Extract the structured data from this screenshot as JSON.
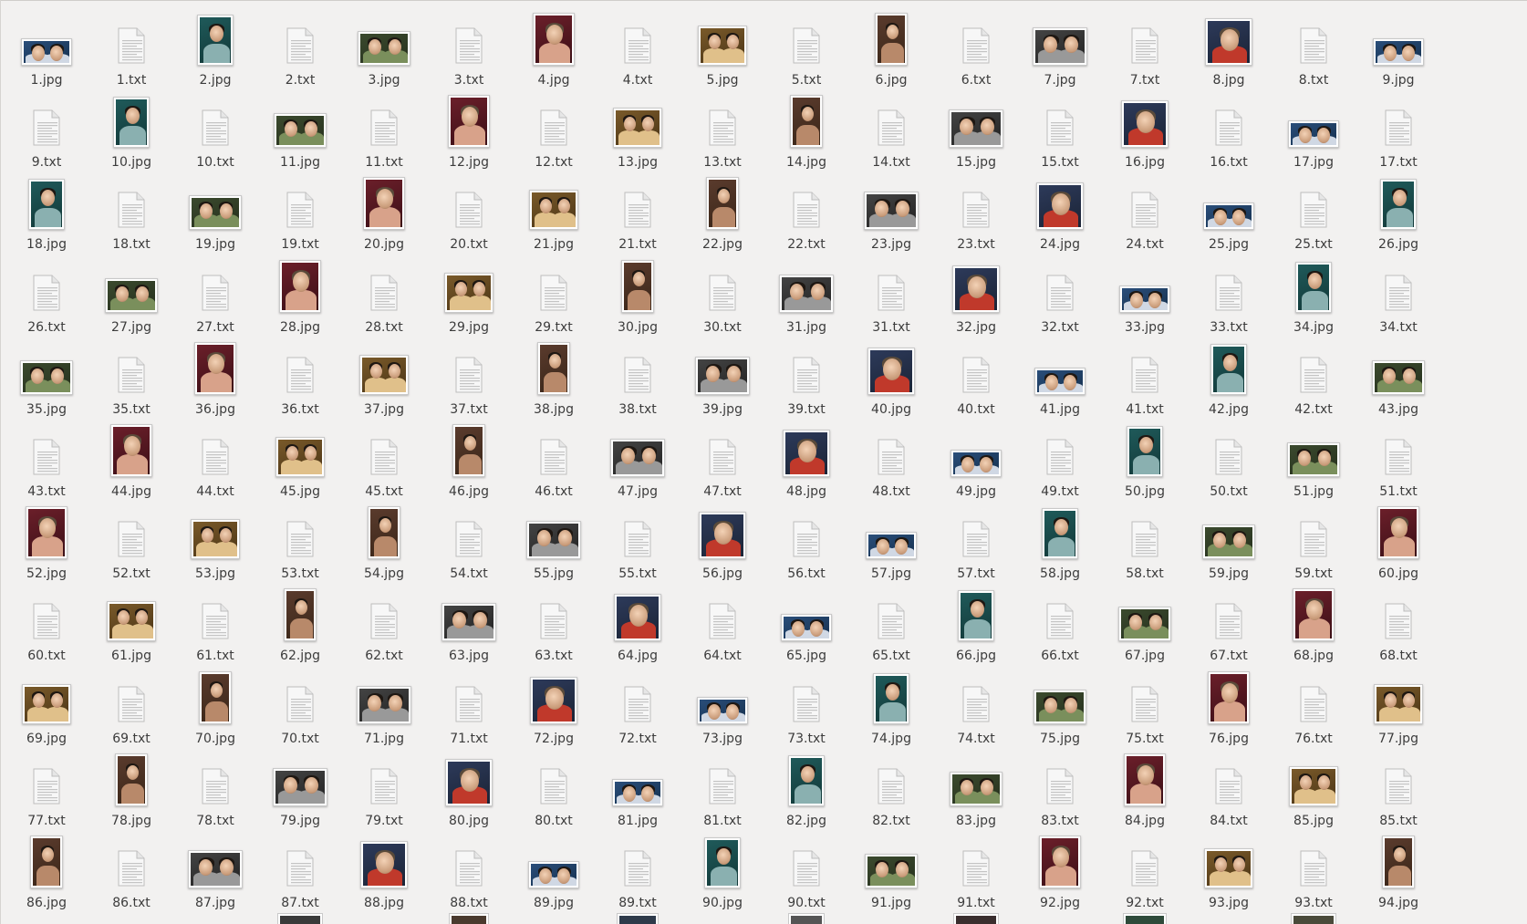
{
  "file_manager": {
    "files": [
      {
        "name": "1.jpg",
        "type": "image"
      },
      {
        "name": "1.txt",
        "type": "text"
      },
      {
        "name": "2.jpg",
        "type": "image"
      },
      {
        "name": "2.txt",
        "type": "text"
      },
      {
        "name": "3.jpg",
        "type": "image"
      },
      {
        "name": "3.txt",
        "type": "text"
      },
      {
        "name": "4.jpg",
        "type": "image"
      },
      {
        "name": "4.txt",
        "type": "text"
      },
      {
        "name": "5.jpg",
        "type": "image"
      },
      {
        "name": "5.txt",
        "type": "text"
      },
      {
        "name": "6.jpg",
        "type": "image"
      },
      {
        "name": "6.txt",
        "type": "text"
      },
      {
        "name": "7.jpg",
        "type": "image"
      },
      {
        "name": "7.txt",
        "type": "text"
      },
      {
        "name": "8.jpg",
        "type": "image"
      },
      {
        "name": "8.txt",
        "type": "text"
      },
      {
        "name": "9.jpg",
        "type": "image"
      },
      {
        "name": "9.txt",
        "type": "text"
      },
      {
        "name": "10.jpg",
        "type": "image"
      },
      {
        "name": "10.txt",
        "type": "text"
      },
      {
        "name": "11.jpg",
        "type": "image"
      },
      {
        "name": "11.txt",
        "type": "text"
      },
      {
        "name": "12.jpg",
        "type": "image"
      },
      {
        "name": "12.txt",
        "type": "text"
      },
      {
        "name": "13.jpg",
        "type": "image"
      },
      {
        "name": "13.txt",
        "type": "text"
      },
      {
        "name": "14.jpg",
        "type": "image"
      },
      {
        "name": "14.txt",
        "type": "text"
      },
      {
        "name": "15.jpg",
        "type": "image"
      },
      {
        "name": "15.txt",
        "type": "text"
      },
      {
        "name": "16.jpg",
        "type": "image"
      },
      {
        "name": "16.txt",
        "type": "text"
      },
      {
        "name": "17.jpg",
        "type": "image"
      },
      {
        "name": "17.txt",
        "type": "text"
      },
      {
        "name": "18.jpg",
        "type": "image"
      },
      {
        "name": "18.txt",
        "type": "text"
      },
      {
        "name": "19.jpg",
        "type": "image"
      },
      {
        "name": "19.txt",
        "type": "text"
      },
      {
        "name": "20.jpg",
        "type": "image"
      },
      {
        "name": "20.txt",
        "type": "text"
      },
      {
        "name": "21.jpg",
        "type": "image"
      },
      {
        "name": "21.txt",
        "type": "text"
      },
      {
        "name": "22.jpg",
        "type": "image"
      },
      {
        "name": "22.txt",
        "type": "text"
      },
      {
        "name": "23.jpg",
        "type": "image"
      },
      {
        "name": "23.txt",
        "type": "text"
      },
      {
        "name": "24.jpg",
        "type": "image"
      },
      {
        "name": "24.txt",
        "type": "text"
      },
      {
        "name": "25.jpg",
        "type": "image"
      },
      {
        "name": "25.txt",
        "type": "text"
      },
      {
        "name": "26.jpg",
        "type": "image"
      },
      {
        "name": "26.txt",
        "type": "text"
      },
      {
        "name": "27.jpg",
        "type": "image"
      },
      {
        "name": "27.txt",
        "type": "text"
      },
      {
        "name": "28.jpg",
        "type": "image"
      },
      {
        "name": "28.txt",
        "type": "text"
      },
      {
        "name": "29.jpg",
        "type": "image"
      },
      {
        "name": "29.txt",
        "type": "text"
      },
      {
        "name": "30.jpg",
        "type": "image"
      },
      {
        "name": "30.txt",
        "type": "text"
      },
      {
        "name": "31.jpg",
        "type": "image"
      },
      {
        "name": "31.txt",
        "type": "text"
      },
      {
        "name": "32.jpg",
        "type": "image"
      },
      {
        "name": "32.txt",
        "type": "text"
      },
      {
        "name": "33.jpg",
        "type": "image"
      },
      {
        "name": "33.txt",
        "type": "text"
      },
      {
        "name": "34.jpg",
        "type": "image"
      },
      {
        "name": "34.txt",
        "type": "text"
      },
      {
        "name": "35.jpg",
        "type": "image"
      },
      {
        "name": "35.txt",
        "type": "text"
      },
      {
        "name": "36.jpg",
        "type": "image"
      },
      {
        "name": "36.txt",
        "type": "text"
      },
      {
        "name": "37.jpg",
        "type": "image"
      },
      {
        "name": "37.txt",
        "type": "text"
      },
      {
        "name": "38.jpg",
        "type": "image"
      },
      {
        "name": "38.txt",
        "type": "text"
      },
      {
        "name": "39.jpg",
        "type": "image"
      },
      {
        "name": "39.txt",
        "type": "text"
      },
      {
        "name": "40.jpg",
        "type": "image"
      },
      {
        "name": "40.txt",
        "type": "text"
      },
      {
        "name": "41.jpg",
        "type": "image"
      },
      {
        "name": "41.txt",
        "type": "text"
      },
      {
        "name": "42.jpg",
        "type": "image"
      },
      {
        "name": "42.txt",
        "type": "text"
      },
      {
        "name": "43.jpg",
        "type": "image"
      },
      {
        "name": "43.txt",
        "type": "text"
      },
      {
        "name": "44.jpg",
        "type": "image"
      },
      {
        "name": "44.txt",
        "type": "text"
      },
      {
        "name": "45.jpg",
        "type": "image"
      },
      {
        "name": "45.txt",
        "type": "text"
      },
      {
        "name": "46.jpg",
        "type": "image"
      },
      {
        "name": "46.txt",
        "type": "text"
      },
      {
        "name": "47.jpg",
        "type": "image"
      },
      {
        "name": "47.txt",
        "type": "text"
      },
      {
        "name": "48.jpg",
        "type": "image"
      },
      {
        "name": "48.txt",
        "type": "text"
      },
      {
        "name": "49.jpg",
        "type": "image"
      },
      {
        "name": "49.txt",
        "type": "text"
      },
      {
        "name": "50.jpg",
        "type": "image"
      },
      {
        "name": "50.txt",
        "type": "text"
      },
      {
        "name": "51.jpg",
        "type": "image"
      },
      {
        "name": "51.txt",
        "type": "text"
      },
      {
        "name": "52.jpg",
        "type": "image"
      },
      {
        "name": "52.txt",
        "type": "text"
      },
      {
        "name": "53.jpg",
        "type": "image"
      },
      {
        "name": "53.txt",
        "type": "text"
      },
      {
        "name": "54.jpg",
        "type": "image"
      },
      {
        "name": "54.txt",
        "type": "text"
      },
      {
        "name": "55.jpg",
        "type": "image"
      },
      {
        "name": "55.txt",
        "type": "text"
      },
      {
        "name": "56.jpg",
        "type": "image"
      },
      {
        "name": "56.txt",
        "type": "text"
      },
      {
        "name": "57.jpg",
        "type": "image"
      },
      {
        "name": "57.txt",
        "type": "text"
      },
      {
        "name": "58.jpg",
        "type": "image"
      },
      {
        "name": "58.txt",
        "type": "text"
      },
      {
        "name": "59.jpg",
        "type": "image"
      },
      {
        "name": "59.txt",
        "type": "text"
      },
      {
        "name": "60.jpg",
        "type": "image"
      },
      {
        "name": "60.txt",
        "type": "text"
      },
      {
        "name": "61.jpg",
        "type": "image"
      },
      {
        "name": "61.txt",
        "type": "text"
      },
      {
        "name": "62.jpg",
        "type": "image"
      },
      {
        "name": "62.txt",
        "type": "text"
      },
      {
        "name": "63.jpg",
        "type": "image"
      },
      {
        "name": "63.txt",
        "type": "text"
      },
      {
        "name": "64.jpg",
        "type": "image"
      },
      {
        "name": "64.txt",
        "type": "text"
      },
      {
        "name": "65.jpg",
        "type": "image"
      },
      {
        "name": "65.txt",
        "type": "text"
      },
      {
        "name": "66.jpg",
        "type": "image"
      },
      {
        "name": "66.txt",
        "type": "text"
      },
      {
        "name": "67.jpg",
        "type": "image"
      },
      {
        "name": "67.txt",
        "type": "text"
      },
      {
        "name": "68.jpg",
        "type": "image"
      },
      {
        "name": "68.txt",
        "type": "text"
      },
      {
        "name": "69.jpg",
        "type": "image"
      },
      {
        "name": "69.txt",
        "type": "text"
      },
      {
        "name": "70.jpg",
        "type": "image"
      },
      {
        "name": "70.txt",
        "type": "text"
      },
      {
        "name": "71.jpg",
        "type": "image"
      },
      {
        "name": "71.txt",
        "type": "text"
      },
      {
        "name": "72.jpg",
        "type": "image"
      },
      {
        "name": "72.txt",
        "type": "text"
      },
      {
        "name": "73.jpg",
        "type": "image"
      },
      {
        "name": "73.txt",
        "type": "text"
      },
      {
        "name": "74.jpg",
        "type": "image"
      },
      {
        "name": "74.txt",
        "type": "text"
      },
      {
        "name": "75.jpg",
        "type": "image"
      },
      {
        "name": "75.txt",
        "type": "text"
      },
      {
        "name": "76.jpg",
        "type": "image"
      },
      {
        "name": "76.txt",
        "type": "text"
      },
      {
        "name": "77.jpg",
        "type": "image"
      },
      {
        "name": "77.txt",
        "type": "text"
      },
      {
        "name": "78.jpg",
        "type": "image"
      },
      {
        "name": "78.txt",
        "type": "text"
      },
      {
        "name": "79.jpg",
        "type": "image"
      },
      {
        "name": "79.txt",
        "type": "text"
      },
      {
        "name": "80.jpg",
        "type": "image"
      },
      {
        "name": "80.txt",
        "type": "text"
      },
      {
        "name": "81.jpg",
        "type": "image"
      },
      {
        "name": "81.txt",
        "type": "text"
      },
      {
        "name": "82.jpg",
        "type": "image"
      },
      {
        "name": "82.txt",
        "type": "text"
      },
      {
        "name": "83.jpg",
        "type": "image"
      },
      {
        "name": "83.txt",
        "type": "text"
      },
      {
        "name": "84.jpg",
        "type": "image"
      },
      {
        "name": "84.txt",
        "type": "text"
      },
      {
        "name": "85.jpg",
        "type": "image"
      },
      {
        "name": "85.txt",
        "type": "text"
      },
      {
        "name": "86.jpg",
        "type": "image"
      },
      {
        "name": "86.txt",
        "type": "text"
      },
      {
        "name": "87.jpg",
        "type": "image"
      },
      {
        "name": "87.txt",
        "type": "text"
      },
      {
        "name": "88.jpg",
        "type": "image"
      },
      {
        "name": "88.txt",
        "type": "text"
      },
      {
        "name": "89.jpg",
        "type": "image"
      },
      {
        "name": "89.txt",
        "type": "text"
      },
      {
        "name": "90.jpg",
        "type": "image"
      },
      {
        "name": "90.txt",
        "type": "text"
      },
      {
        "name": "91.jpg",
        "type": "image"
      },
      {
        "name": "91.txt",
        "type": "text"
      },
      {
        "name": "92.jpg",
        "type": "image"
      },
      {
        "name": "92.txt",
        "type": "text"
      },
      {
        "name": "93.jpg",
        "type": "image"
      },
      {
        "name": "93.txt",
        "type": "text"
      },
      {
        "name": "94.jpg",
        "type": "image"
      }
    ],
    "colors": {
      "background": "#f2f1f0",
      "label": "#3c3c3c",
      "doc_page": "#f7f7f7",
      "doc_line": "#c4c4c4"
    }
  }
}
